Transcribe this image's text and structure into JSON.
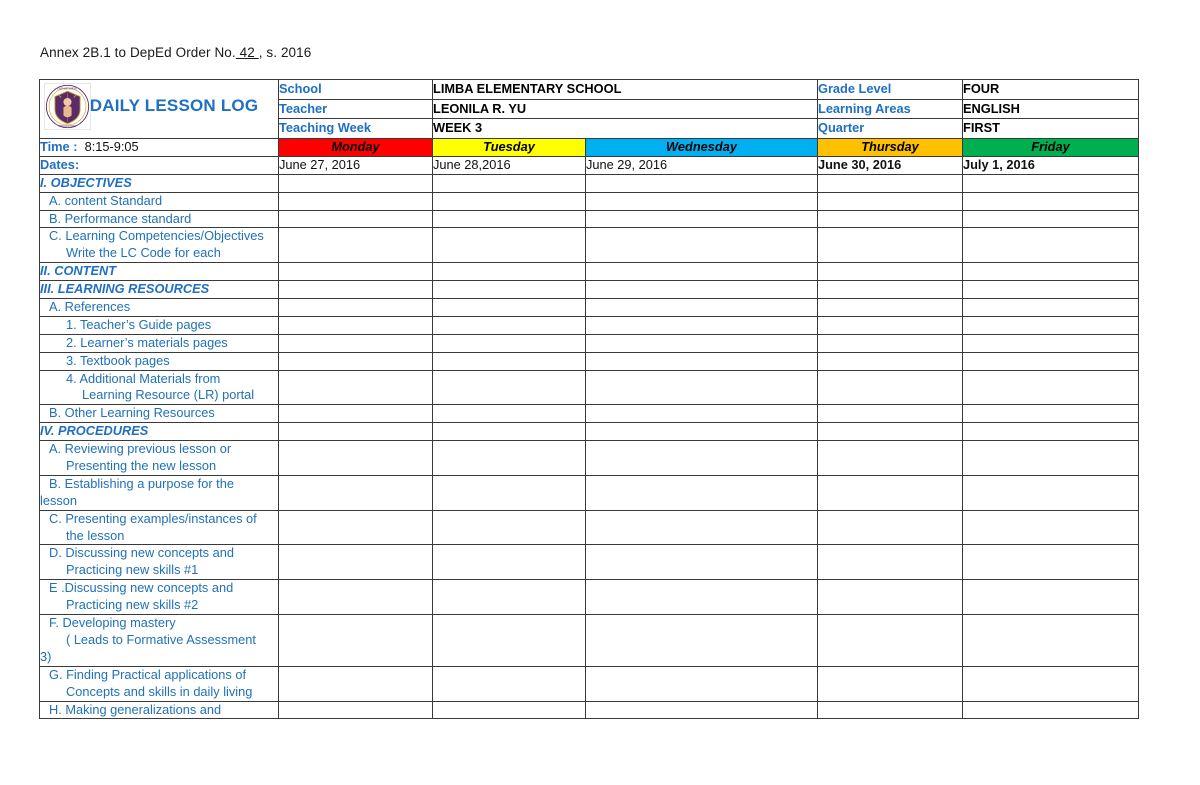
{
  "document": {
    "annex_prefix": "Annex 2B.1 to DepEd Order No.",
    "annex_number": " 42 ",
    "annex_suffix": ", s. 2016",
    "title": "DAILY LESSON LOG",
    "logo_name": "deped-seal"
  },
  "colors": {
    "header_fill": "#F4AE7E",
    "label_blue": "#1F6FC4",
    "item_blue": "#2171B5",
    "monday": "#FF0000",
    "tuesday": "#FFFF00",
    "wednesday": "#00B0F0",
    "thursday": "#FFC000",
    "friday": "#00B050"
  },
  "identification": {
    "rows": [
      {
        "label": "School",
        "value": "LIMBA ELEMENTARY SCHOOL",
        "label2": "Grade Level",
        "value2": "FOUR"
      },
      {
        "label": "Teacher",
        "value": "LEONILA R. YU",
        "label2": "Learning Areas",
        "value2": "ENGLISH"
      },
      {
        "label": "Teaching  Week",
        "value": "WEEK 3",
        "label2": "Quarter",
        "value2": "FIRST"
      }
    ]
  },
  "schedule": {
    "time_label": "Time :",
    "time_value": "8:15-9:05",
    "dates_label": "Dates:",
    "days": [
      {
        "name": "Monday",
        "color": "#FF0000",
        "date": "June 27, 2016",
        "bold": false
      },
      {
        "name": "Tuesday",
        "color": "#FFFF00",
        "date": "June 28,2016",
        "bold": false
      },
      {
        "name": "Wednesday",
        "color": "#00B0F0",
        "date": "June 29, 2016",
        "bold": false
      },
      {
        "name": "Thursday",
        "color": "#FFC000",
        "date": "June 30, 2016",
        "bold": true
      },
      {
        "name": "Friday",
        "color": "#00B050",
        "date": "July 1, 2016",
        "bold": true
      }
    ]
  },
  "rows": [
    {
      "type": "section",
      "lines": [
        {
          "indent": 0,
          "text": "I. OBJECTIVES"
        }
      ]
    },
    {
      "type": "item",
      "lines": [
        {
          "indent": 1,
          "text": "A. content Standard"
        }
      ]
    },
    {
      "type": "item",
      "lines": [
        {
          "indent": 1,
          "text": "B. Performance standard"
        }
      ]
    },
    {
      "type": "item",
      "lines": [
        {
          "indent": 1,
          "text": "C. Learning Competencies/Objectives"
        },
        {
          "indent": 2,
          "text": "Write the LC Code for each"
        }
      ]
    },
    {
      "type": "section",
      "lines": [
        {
          "indent": 0,
          "text": "II. CONTENT"
        }
      ]
    },
    {
      "type": "section",
      "lines": [
        {
          "indent": 0,
          "text": "III. LEARNING RESOURCES"
        }
      ]
    },
    {
      "type": "item",
      "lines": [
        {
          "indent": 1,
          "text": "A. References"
        }
      ]
    },
    {
      "type": "item",
      "lines": [
        {
          "indent": 2,
          "text": "1. Teacher’s Guide pages"
        }
      ]
    },
    {
      "type": "item",
      "lines": [
        {
          "indent": 2,
          "text": "2. Learner’s materials pages"
        }
      ]
    },
    {
      "type": "item",
      "lines": [
        {
          "indent": 2,
          "text": "3. Textbook pages"
        }
      ]
    },
    {
      "type": "item",
      "lines": [
        {
          "indent": 2,
          "text": "4. Additional Materials from"
        },
        {
          "indent": 3,
          "text": "Learning Resource (LR) portal"
        }
      ]
    },
    {
      "type": "item",
      "lines": [
        {
          "indent": 1,
          "text": "B. Other Learning Resources"
        }
      ]
    },
    {
      "type": "section",
      "lines": [
        {
          "indent": 0,
          "text": "IV. PROCEDURES"
        }
      ]
    },
    {
      "type": "item",
      "lines": [
        {
          "indent": 1,
          "text": "A. Reviewing previous lesson or"
        },
        {
          "indent": 2,
          "text": "Presenting the new lesson"
        }
      ]
    },
    {
      "type": "item",
      "lines": [
        {
          "indent": 1,
          "text": "B. Establishing a purpose for the"
        },
        {
          "indent": 0,
          "text": "lesson"
        }
      ]
    },
    {
      "type": "item",
      "lines": [
        {
          "indent": 1,
          "text": "C. Presenting examples/instances of"
        },
        {
          "indent": 2,
          "text": "the lesson"
        }
      ]
    },
    {
      "type": "item",
      "lines": [
        {
          "indent": 1,
          "text": "D. Discussing new concepts and"
        },
        {
          "indent": 2,
          "text": "Practicing new skills #1"
        }
      ]
    },
    {
      "type": "item",
      "lines": [
        {
          "indent": 1,
          "text": "E .Discussing new concepts and"
        },
        {
          "indent": 2,
          "text": "Practicing new skills #2"
        }
      ]
    },
    {
      "type": "item",
      "lines": [
        {
          "indent": 1,
          "text": "F. Developing mastery"
        },
        {
          "indent": 2,
          "text": "( Leads to Formative Assessment"
        },
        {
          "indent": 0,
          "text": "3)"
        }
      ]
    },
    {
      "type": "item",
      "lines": [
        {
          "indent": 1,
          "text": "G. Finding Practical applications of"
        },
        {
          "indent": 2,
          "text": "Concepts and skills in daily living"
        }
      ]
    },
    {
      "type": "item",
      "lines": [
        {
          "indent": 1,
          "text": "H. Making  generalizations and"
        }
      ]
    }
  ]
}
